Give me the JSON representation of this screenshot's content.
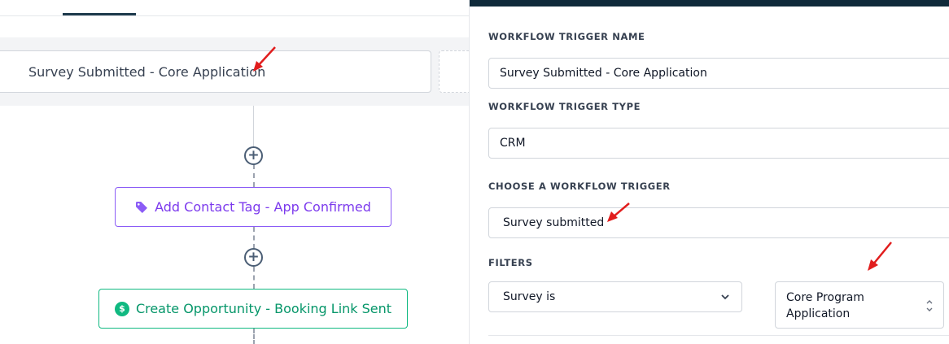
{
  "canvas": {
    "trigger_card_label": "Survey Submitted - Core Application",
    "actions": [
      {
        "label": "Add Contact Tag - App Confirmed",
        "icon": "tag-icon",
        "color": "#7c3aed"
      },
      {
        "label": "Create Opportunity - Booking Link Sent",
        "icon": "dollar-icon",
        "color": "#059669"
      }
    ],
    "plus_symbol": "+",
    "dollar_symbol": "$"
  },
  "panel": {
    "trigger_name_label": "WORKFLOW TRIGGER NAME",
    "trigger_name_value": "Survey Submitted - Core Application",
    "trigger_type_label": "WORKFLOW TRIGGER TYPE",
    "trigger_type_value": "CRM",
    "choose_trigger_label": "CHOOSE A WORKFLOW TRIGGER",
    "choose_trigger_value": "Survey submitted",
    "filters_label": "FILTERS",
    "filter_field_value": "Survey is",
    "filter_value_value": "Core Program Application"
  },
  "colors": {
    "header_bg": "#0f2a3a",
    "annotation_arrow": "#e11d1d"
  }
}
